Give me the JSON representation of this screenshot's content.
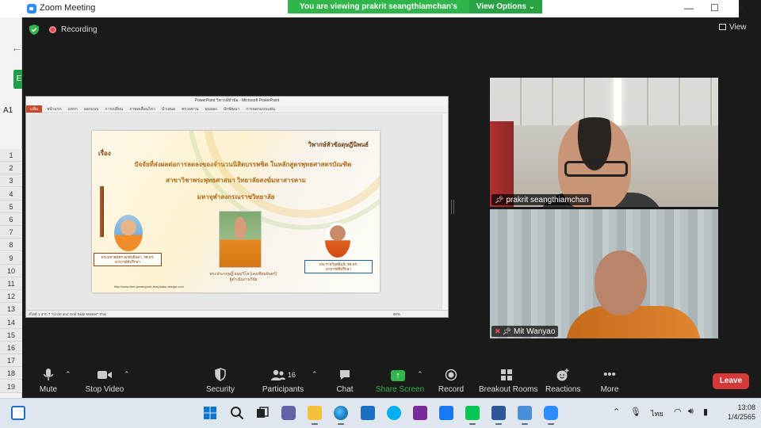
{
  "window": {
    "title": "Zoom Meeting",
    "share_banner": "You are viewing prakrit seangthiamchan's screen",
    "view_options": "View Options ⌄",
    "min": "—",
    "max": "☐",
    "close": "✕"
  },
  "status": {
    "recording": "Recording",
    "view": "View"
  },
  "excel": {
    "cell_ref": "A1",
    "rows": [
      "1",
      "2",
      "3",
      "4",
      "5",
      "6",
      "7",
      "8",
      "9",
      "10",
      "11",
      "12",
      "13",
      "14",
      "15",
      "16",
      "17",
      "18",
      "19"
    ]
  },
  "ppt": {
    "titlebar": "PowerPoint วิพากษ์หัวข้อ - Microsoft PowerPoint",
    "file_tab": "แฟ้ม",
    "ribbon": [
      "หน้าแรก",
      "แทรก",
      "ออกแบบ",
      "การเปลี่ยน",
      "ภาพเคลื่อนไหว",
      "นำเสนอ",
      "ตรวจทาน",
      "มุมมอง",
      "นักพัฒนา",
      "การออกแบบแผ่น"
    ],
    "status": "สไลด์ 1 จาก 7   \"Circle and Grid Slide Master\"   Thai",
    "zoom": "90%"
  },
  "slide": {
    "review": "วิพากษ์หัวข้อดุษฎีนิพนธ์",
    "topic": "เรื่อง",
    "line1": "ปัจจัยที่ส่งผลต่อการลดลงของจำนวนนิสิตบรรพชิต ในหลักสูตรพุทธศาสตรบัณฑิต",
    "line2": "สาขาวิชาพระพุทธศาสนา วิทยาลัยสงฆ์มหาสารคาม",
    "line3": "มหาจุฬาลงกรณราชวิทยาลัย",
    "name1a": "พระมหาสมัคร สุภดับจินดา, รศ.ดร.",
    "name1b": "อาจารย์ที่ปรึกษา",
    "name2a": "พระประกฤษฎิ์ ธมมวิโส (เสงเทียมจันทร์)",
    "name2b": "ผู้ดำเนินงานวิจัย",
    "name3a": "พระราชวิสุทธิมุนี, รศ.ดร.",
    "name3b": "อาจารย์ที่ปรึกษา",
    "url": "http://www.free-powerpoint-templates-design.com"
  },
  "participants_video": [
    {
      "name": "prakrit seangthiamchan"
    },
    {
      "name": "Mit Wanyao"
    }
  ],
  "toolbar": {
    "mute": "Mute",
    "stop_video": "Stop Video",
    "security": "Security",
    "participants": "Participants",
    "participants_count": "16",
    "chat": "Chat",
    "share_screen": "Share Screen",
    "record": "Record",
    "breakout": "Breakout Rooms",
    "reactions": "Reactions",
    "more": "More",
    "leave": "Leave"
  },
  "taskbar": {
    "lang": "ไทย",
    "time": "13:08",
    "date": "1/4/2565"
  },
  "colors": {
    "accent_green": "#2fb54a",
    "leave_red": "#d43a3a",
    "zoom_blue": "#2d8cff"
  }
}
